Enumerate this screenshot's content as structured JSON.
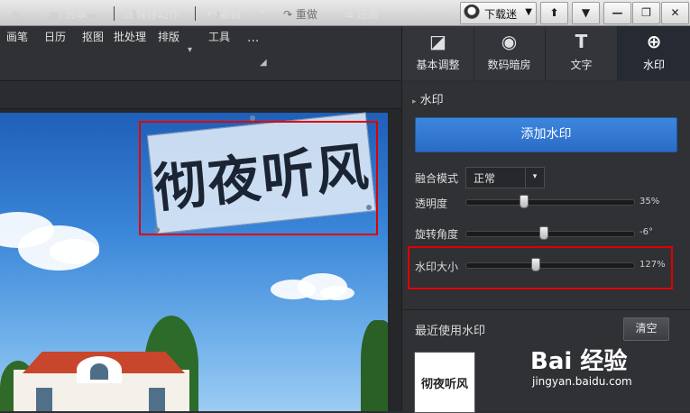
{
  "titlebar": {
    "username": "下载迷",
    "dropdown_glyph": "▼",
    "buttons": [
      {
        "name": "skin",
        "glyph": "⬆"
      },
      {
        "name": "menu",
        "glyph": "▼"
      },
      {
        "name": "minimize",
        "glyph": "—"
      },
      {
        "name": "restore",
        "glyph": "❐"
      },
      {
        "name": "close",
        "glyph": "✕"
      }
    ]
  },
  "toolbar": {
    "tools": [
      {
        "label": "画笔",
        "icon": "brush-icon",
        "glyph": "✎"
      },
      {
        "label": "日历",
        "icon": "calendar-icon",
        "glyph": "▦"
      },
      {
        "label": "抠图",
        "icon": "pen-icon",
        "glyph": "✒"
      },
      {
        "label": "批处理",
        "icon": "batch-icon",
        "glyph": "❐"
      },
      {
        "label": "排版",
        "icon": "layout-icon",
        "glyph": "▤"
      },
      {
        "label": "工具",
        "icon": "wrench-icon",
        "glyph": "✗"
      }
    ],
    "more_glyph": "···",
    "corner_glyph": "◢",
    "layout_dd": "▾"
  },
  "right_tabs": [
    {
      "label": "基本调整",
      "icon": "adjust-icon",
      "glyph": "◪"
    },
    {
      "label": "数码暗房",
      "icon": "camera-icon",
      "glyph": "◉"
    },
    {
      "label": "文字",
      "icon": "text-icon",
      "glyph": "T"
    },
    {
      "label": "水印",
      "icon": "watermark-icon",
      "glyph": "⊕",
      "active": true
    }
  ],
  "subbar": {
    "share": "分享",
    "save_action": "保存动作",
    "undo": "撤销",
    "redo": "重做",
    "restore": "还原",
    "share_glyph": "⟨",
    "save_glyph": "⊡",
    "undo_glyph": "↶",
    "redo_glyph": "↷",
    "restore_glyph": "≡",
    "undo_dd": "▾"
  },
  "canvas": {
    "watermark_text": "彻夜听风"
  },
  "panel": {
    "title": "水印",
    "title_glyph": "▸",
    "add_button": "添加水印",
    "blend_label": "融合模式",
    "blend_value": "正常",
    "blend_dd": "▾",
    "sliders": [
      {
        "label": "透明度",
        "value_text": "35%",
        "fraction": 0.35
      },
      {
        "label": "旋转角度",
        "value_text": "-6°",
        "fraction": 0.47
      },
      {
        "label": "水印大小",
        "value_text": "127%",
        "fraction": 0.42
      }
    ],
    "recent_title": "最近使用水印",
    "clear_button": "清空",
    "recent_thumb_text": "彻夜听风"
  },
  "branding": {
    "logo_text": "Bai 经验",
    "url": "jingyan.baidu.com"
  }
}
